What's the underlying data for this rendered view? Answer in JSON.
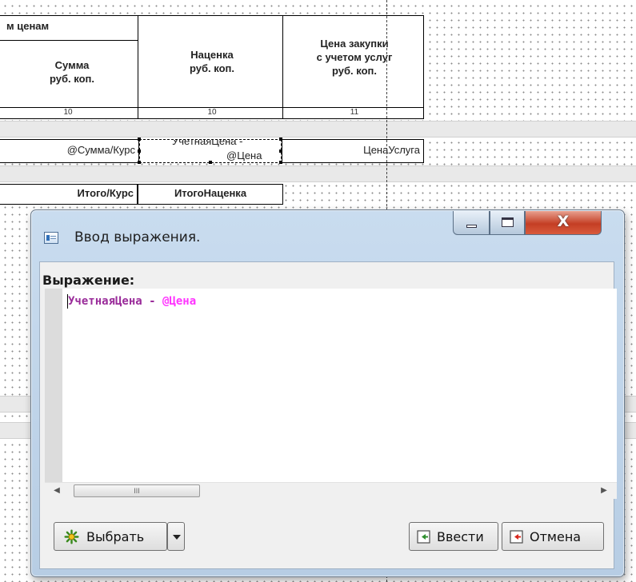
{
  "report": {
    "header_group_title": "м ценам",
    "col_sum": "Сумма\nруб. коп.",
    "col_markup": "Наценка\nруб. коп.",
    "col_purchase_price": "Цена закупки\nс учетом услуг\nруб. коп.",
    "colnum_sum": "10",
    "colnum_markup": "10",
    "colnum_purchase": "11",
    "field_sum": "@Сумма/Курс",
    "field_markup_line1": "УчетнаяЦена -",
    "field_markup_line2": "@Цена",
    "field_service_price": "ЦенаУслуга",
    "total_sum": "Итого/Курс",
    "total_markup": "ИтогоНаценка"
  },
  "dialog": {
    "title": "Ввод выражения.",
    "expression_label": "Выражение:",
    "expression_identifier": "УчетнаяЦена",
    "expression_operator": " - ",
    "expression_parameter": "@Цена",
    "scroll_thumb_grip": "III",
    "select_button": "Выбрать",
    "enter_button": "Ввести",
    "cancel_button": "Отмена",
    "close_glyph": "X"
  },
  "colors": {
    "identifier": "#9a2c9a",
    "parameter": "#ff33ff",
    "titlebar": "#c9dcef",
    "close_button": "#c43e24"
  },
  "icons": [
    "window-app-icon",
    "minimize-icon",
    "maximize-icon",
    "close-icon",
    "select-icon",
    "dropdown-arrow-icon",
    "enter-icon",
    "cancel-icon",
    "scroll-left-icon",
    "scroll-right-icon"
  ]
}
